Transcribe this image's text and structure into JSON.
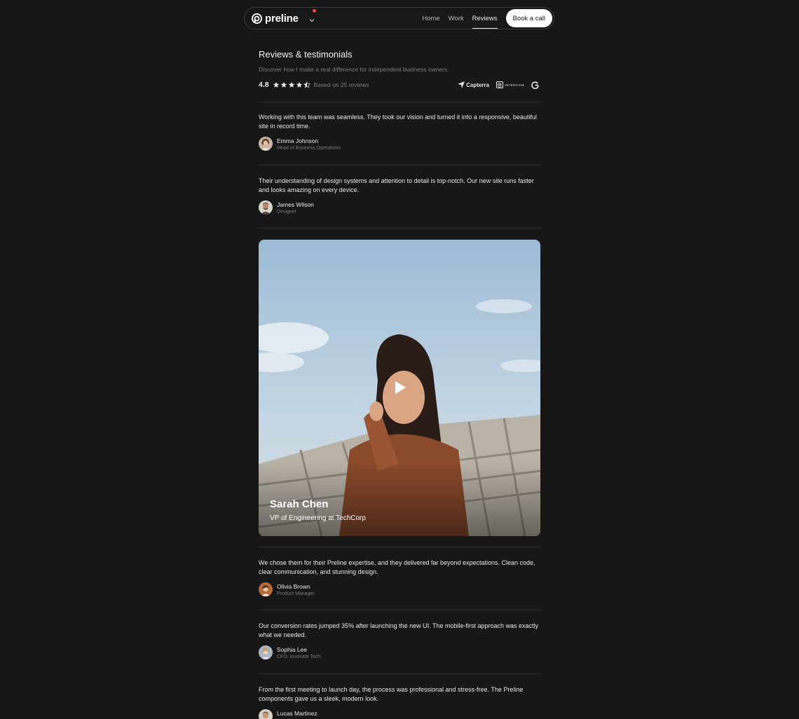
{
  "nav": {
    "brand": "preline",
    "links": [
      "Home",
      "Work",
      "Reviews"
    ],
    "active": "Reviews",
    "cta": "Book a call"
  },
  "section": {
    "title": "Reviews & testimonials",
    "subtitle": "Discover how I make a real difference for independent business owners.",
    "rating": "4.8",
    "stars": 4.5,
    "based_on": "Based on 25 reviews",
    "partners": [
      "Capterra",
      "INTERCOM",
      "G2-icon"
    ]
  },
  "reviews": [
    {
      "text": "Working with this team was seamless. They took our vision and turned it into a responsive, beautiful site in record time.",
      "name": "Emma Johnson",
      "role": "Head of Business Operations"
    },
    {
      "text": "Their understanding of design systems and attention to detail is top-notch. Our new site runs faster and looks amazing on every device.",
      "name": "James Wilson",
      "role": "Designer"
    },
    {
      "text": "We chose them for their Preline expertise, and they delivered far beyond expectations. Clean code, clear communication, and stunning design.",
      "name": "Olivia Brown",
      "role": "Product Manager"
    },
    {
      "text": "Our conversion rates jumped 35% after launching the new UI. The mobile-first approach was exactly what we needed.",
      "name": "Sophia Lee",
      "role": "CFO, Innovate Tech"
    },
    {
      "text": "From the first meeting to launch day, the process was professional and stress-free. The Preline components gave us a sleek, modern look.",
      "name": "Lucas Martinez",
      "role": ""
    }
  ],
  "video": {
    "name": "Sarah Chen",
    "role": "VP of Engineering at TechCorp"
  },
  "colors": {
    "background": "#171717",
    "notification": "#ef4444",
    "cta_bg": "#ffffff"
  }
}
